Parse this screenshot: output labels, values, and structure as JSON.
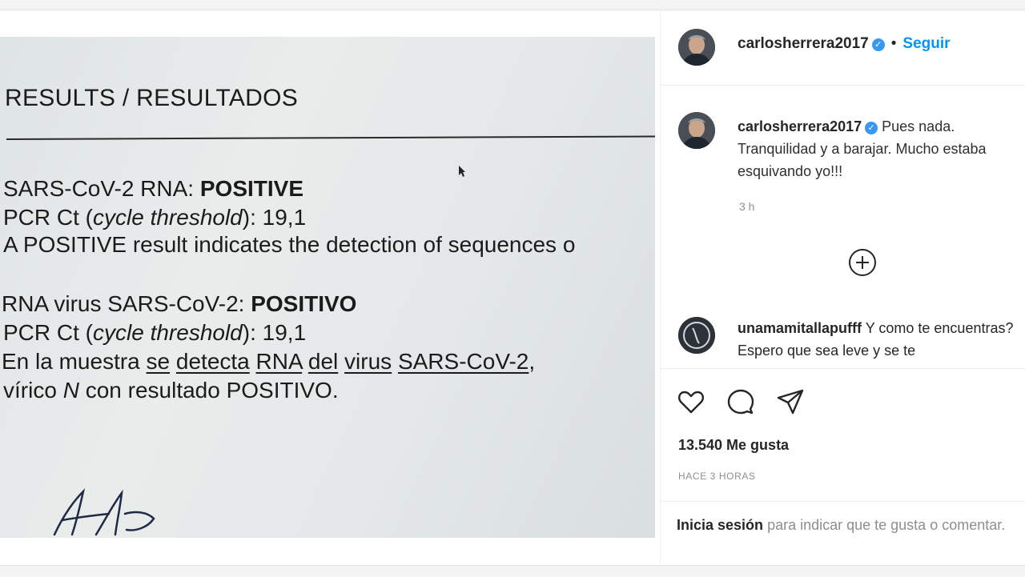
{
  "photo": {
    "heading": "RESULTS / RESULTADOS",
    "en": {
      "rna_label": "SARS-CoV-2 RNA: ",
      "rna_result": "POSITIVE",
      "pcr_prefix": "PCR Ct (",
      "pcr_italic": "cycle threshold",
      "pcr_suffix": "): 19,1",
      "note": "A POSITIVE result indicates the detection of sequences o"
    },
    "es": {
      "rna_label": "RNA virus SARS-CoV-2: ",
      "rna_result": "POSITIVO",
      "pcr_prefix": "PCR Ct (",
      "pcr_italic": "cycle threshold",
      "pcr_suffix": "): 19,1",
      "line1": [
        "En la muestra ",
        "se",
        " ",
        "detecta",
        " ",
        "RNA",
        " ",
        "del",
        " ",
        "virus",
        " ",
        "SARS-CoV-2",
        ","
      ],
      "line2_prefix": "vírico ",
      "line2_italic": "N",
      "line2_suffix": " con resultado POSITIVO."
    }
  },
  "post": {
    "username": "carlosherrera2017",
    "verified_icon": "✓",
    "separator": "•",
    "follow_label": "Seguir",
    "caption_text": "Pues nada. Tranquilidad y a barajar. Mucho estaba esquivando yo!!!",
    "caption_time": "3 h",
    "comment_username": "unamamitallapufff",
    "comment_text": "Y como te encuentras? Espero que sea leve y se te",
    "likes": "13.540 Me gusta",
    "posted_ago": "HACE 3 HORAS",
    "login_link": "Inicia sesión",
    "login_rest": "para indicar que te gusta o comentar."
  },
  "colors": {
    "accent": "#0095f6",
    "verified": "#3897f0",
    "text": "#262626",
    "muted": "#8e8e8e"
  },
  "icons": [
    "heart-icon",
    "comment-icon",
    "share-icon",
    "load-more-icon",
    "verified-icon"
  ]
}
